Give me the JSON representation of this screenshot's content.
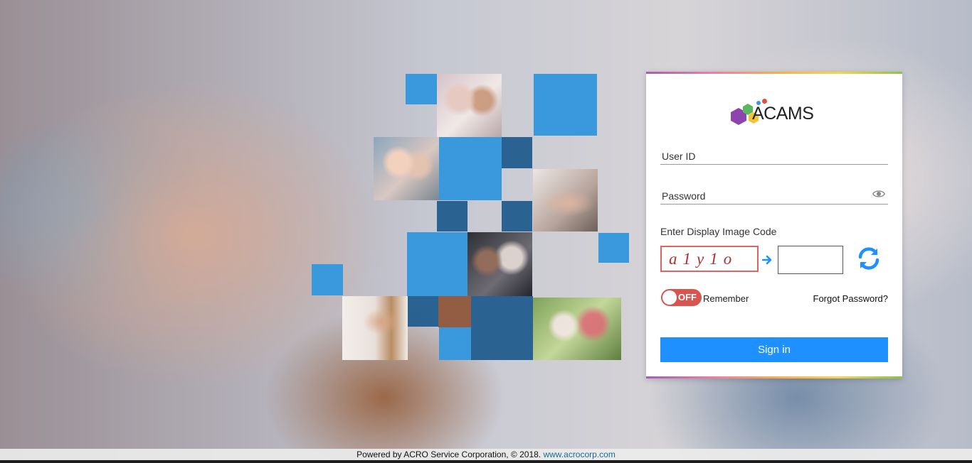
{
  "brand": {
    "logo_text": "ACAMS",
    "colors": {
      "purple": "#8e44ad",
      "green": "#5cb85c",
      "yellow": "#f4c430",
      "red": "#e74c3c",
      "blue": "#3a98dc"
    }
  },
  "login": {
    "user_id_placeholder": "User ID",
    "password_placeholder": "Password",
    "show_password_icon": "eye-icon",
    "captcha_label": "Enter Display Image Code",
    "captcha_code": "a1y1o",
    "captcha_arrow_icon": "arrow-right-icon",
    "refresh_icon": "refresh-icon",
    "remember_toggle_state": "OFF",
    "remember_label": "Remember",
    "forgot_password": "Forgot Password?",
    "sign_in_label": "Sign in",
    "accent_color": "#1e90ff",
    "toggle_color": "#d9534f"
  },
  "footer": {
    "text": "Powered by ACRO Service Corporation, © 2018.",
    "link": "www.acrocorp.com"
  }
}
